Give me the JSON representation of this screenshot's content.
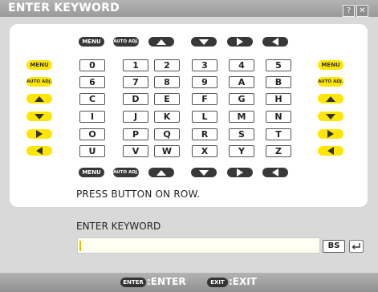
{
  "window": {
    "title": "ENTER KEYWORD",
    "help_label": "?",
    "close_label": "✕"
  },
  "pad": {
    "nav_row": [
      {
        "type": "label",
        "text": "MENU"
      },
      {
        "type": "label",
        "text": "AUTO ADJ."
      },
      {
        "type": "arrow",
        "dir": "up"
      },
      {
        "type": "arrow",
        "dir": "down"
      },
      {
        "type": "arrow",
        "dir": "right"
      },
      {
        "type": "arrow",
        "dir": "left"
      }
    ],
    "rows": [
      {
        "side": {
          "type": "label",
          "text": "MENU"
        },
        "keys": [
          "0",
          "1",
          "2",
          "3",
          "4",
          "5"
        ]
      },
      {
        "side": {
          "type": "label",
          "text": "AUTO ADJ."
        },
        "keys": [
          "6",
          "7",
          "8",
          "9",
          "A",
          "B"
        ]
      },
      {
        "side": {
          "type": "arrow",
          "dir": "up"
        },
        "keys": [
          "C",
          "D",
          "E",
          "F",
          "G",
          "H"
        ]
      },
      {
        "side": {
          "type": "arrow",
          "dir": "down"
        },
        "keys": [
          "I",
          "J",
          "K",
          "L",
          "M",
          "N"
        ]
      },
      {
        "side": {
          "type": "arrow",
          "dir": "right"
        },
        "keys": [
          "O",
          "P",
          "Q",
          "R",
          "S",
          "T"
        ]
      },
      {
        "side": {
          "type": "arrow",
          "dir": "left"
        },
        "keys": [
          "U",
          "V",
          "W",
          "X",
          "Y",
          "Z"
        ]
      }
    ]
  },
  "instruction": "PRESS BUTTON ON ROW.",
  "keyword": {
    "label": "ENTER KEYWORD",
    "value": "",
    "placeholder": "",
    "backspace_label": "BS"
  },
  "footer": {
    "enter_badge": "ENTER",
    "enter_text": ":ENTER",
    "exit_badge": "EXIT",
    "exit_text": ":EXIT"
  },
  "colors": {
    "accent_yellow": "#ffe600",
    "dark_button": "#383838",
    "titlebar": "#a8a8a8",
    "background": "#d9d9d9"
  }
}
